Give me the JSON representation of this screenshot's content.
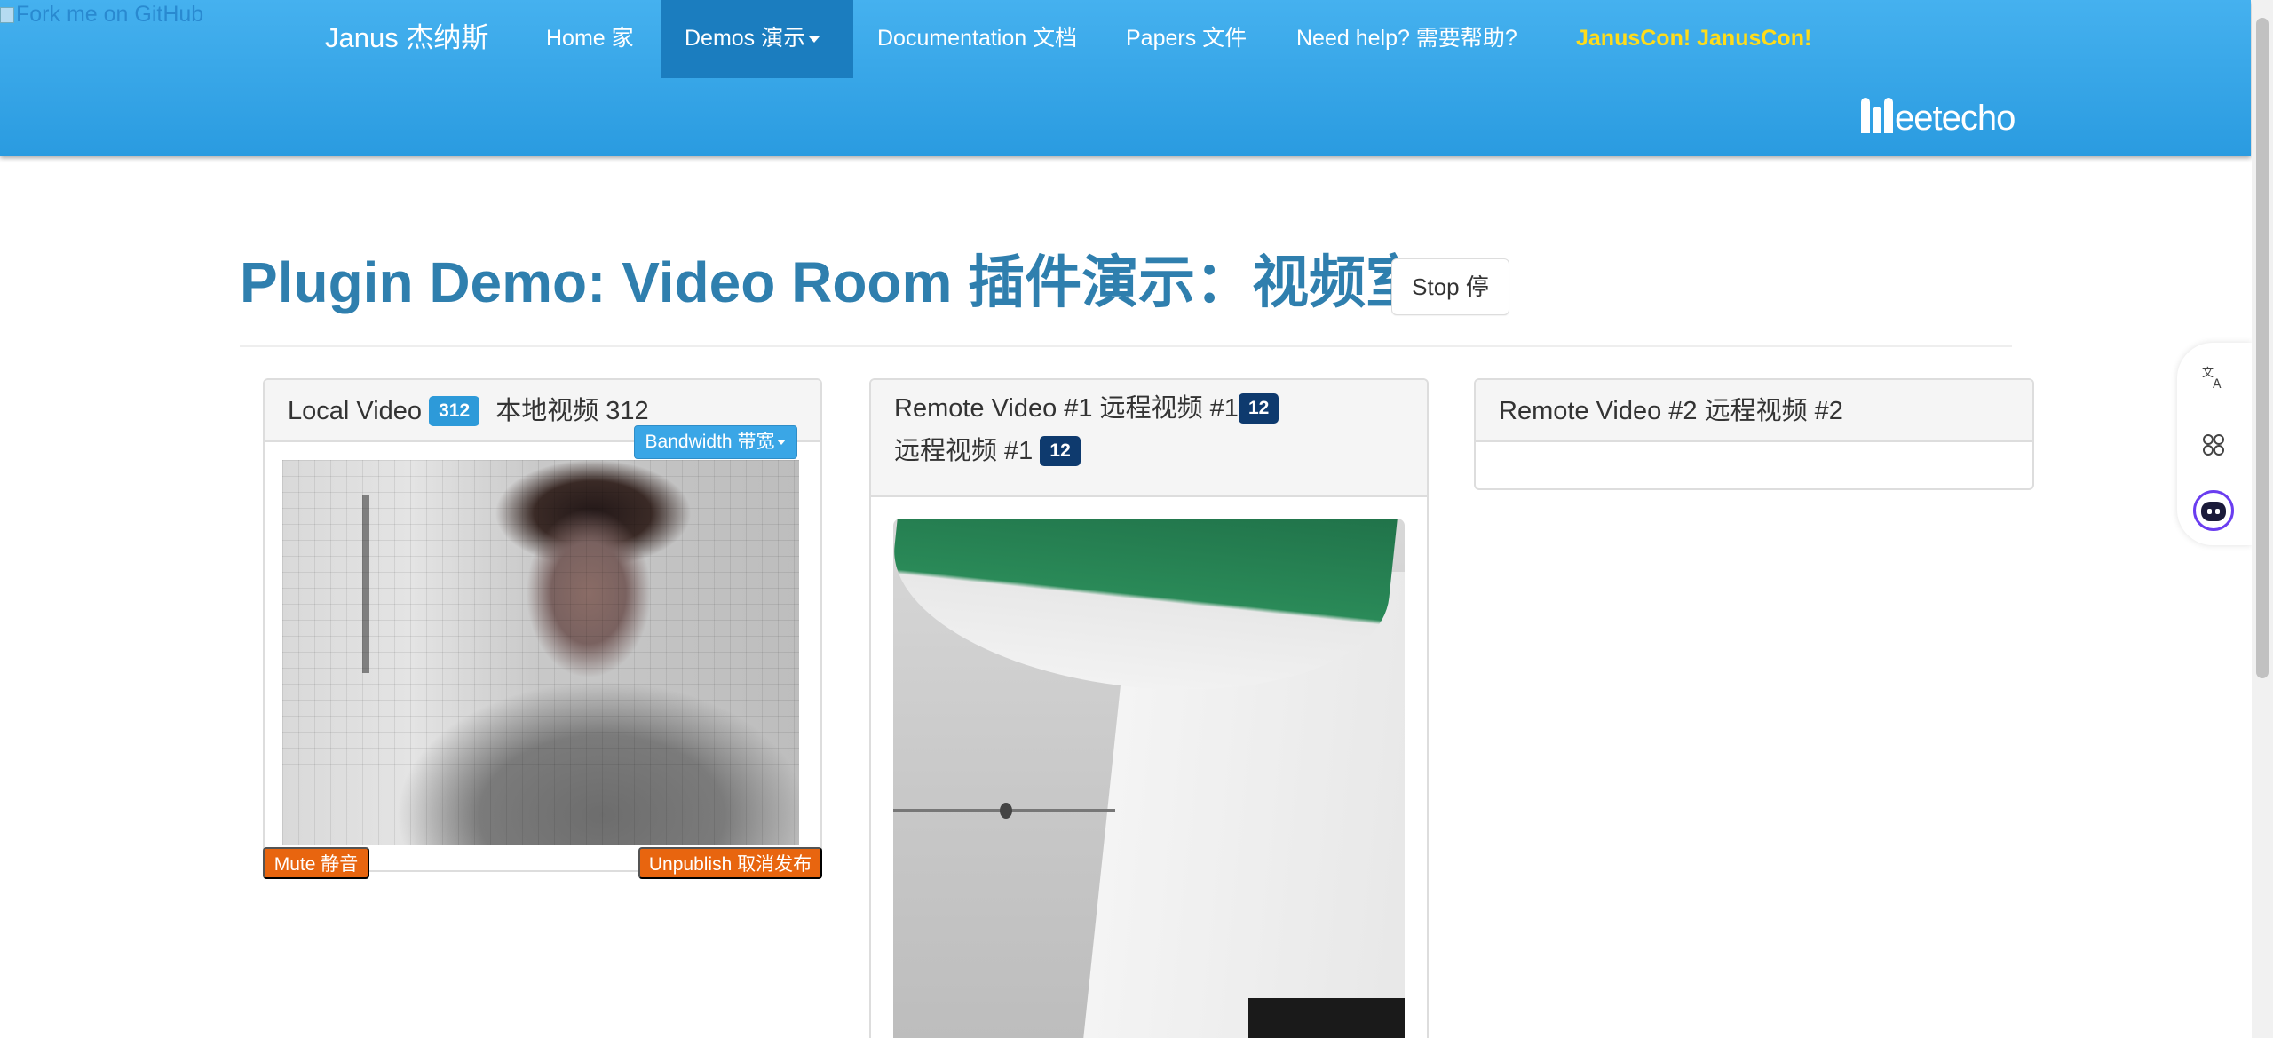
{
  "fork_banner": {
    "alt_text": "Fork me on GitHub"
  },
  "navbar": {
    "brand": "Janus  杰纳斯",
    "items": [
      {
        "label": "Home  家"
      },
      {
        "label": "Demos  演示"
      },
      {
        "label": "Documentation  文档"
      },
      {
        "label": "Papers  文件"
      },
      {
        "label": "Need help?  需要帮助?"
      },
      {
        "label": "JanusCon!  JanusCon!"
      }
    ],
    "active_item": "Demos  演示",
    "logo_text": "eetecho"
  },
  "page": {
    "title": "Plugin Demo: Video Room   插件演示：视频室",
    "stop_button": "Stop  停"
  },
  "local_panel": {
    "title": "Local Video",
    "badge": "312",
    "subtitle": "本地视频 312",
    "bandwidth_button": "Bandwidth  带宽",
    "mute_button": "Mute  静音",
    "unpublish_button": "Unpublish  取消发布"
  },
  "remote1_panel": {
    "title": "Remote Video #1   远程视频 #1",
    "badge": "12",
    "line2": "远程视频 #1",
    "badge2": "12"
  },
  "remote2_panel": {
    "title": "Remote Video #2   远程视频 #2"
  },
  "side_toolbar": {
    "icons": [
      "translate-icon",
      "apps-icon",
      "ai-assistant-icon"
    ]
  },
  "colors": {
    "navbar": "#2a9be0",
    "active_tab": "#1b7dbf",
    "title": "#2f7fae",
    "janus_con": "#ffdc1a",
    "orange_button": "#e8650f",
    "badge_blue": "#2d9ad9",
    "badge_navy": "#0e3a6e"
  }
}
